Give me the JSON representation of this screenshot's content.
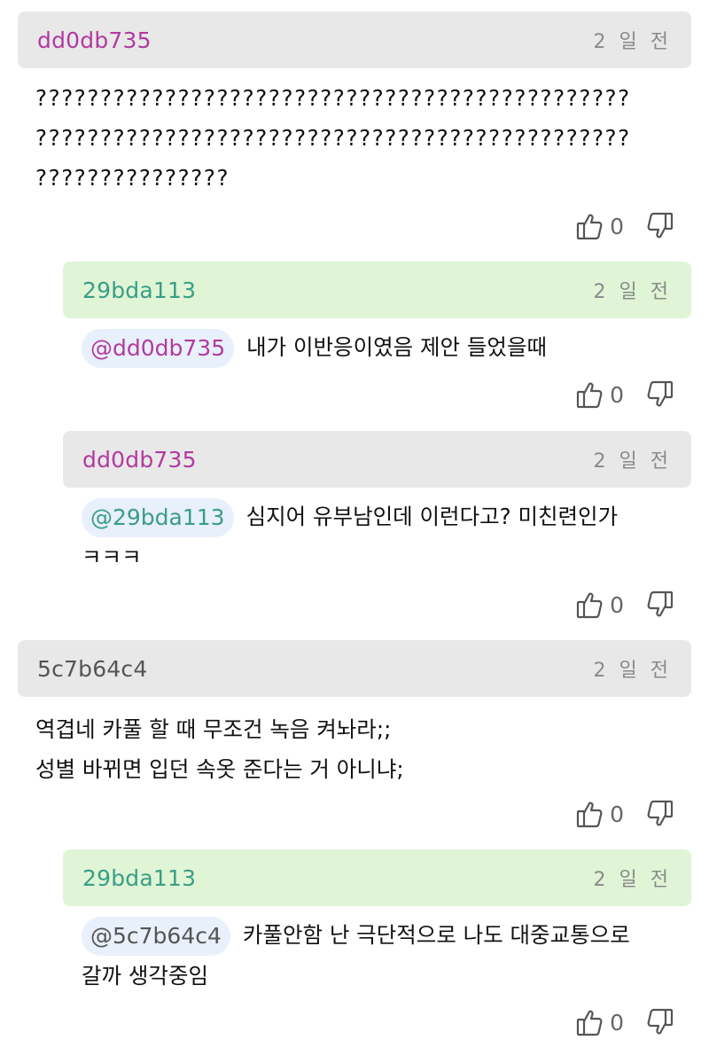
{
  "comments": [
    {
      "author": "dd0db735",
      "time": "2 일 전",
      "text": "?????????????????????????????????????????????????????????????????????????????????????????????????????????",
      "lines": [
        "??????????????????????????????????????????????",
        "??????????????????????????????????????????????",
        "???????????????"
      ],
      "likes": "0",
      "replies": [
        {
          "author": "29bda113",
          "time": "2 일 전",
          "mention": "@dd0db735",
          "lines": [
            "내가 이반응이였음 제안 들었을때"
          ],
          "likes": "0"
        },
        {
          "author": "dd0db735",
          "time": "2 일 전",
          "mention": "@29bda113",
          "lines": [
            "심지어 유부남인데 이런다고? 미친련인가",
            "ㅋㅋㅋ"
          ],
          "likes": "0"
        }
      ]
    },
    {
      "author": "5c7b64c4",
      "time": "2 일 전",
      "lines": [
        "역겹네 카풀 할 때 무조건 녹음 켜놔라;;",
        "성별 바뀌면 입던 속옷 준다는 거 아니냐;"
      ],
      "likes": "0",
      "replies": [
        {
          "author": "29bda113",
          "time": "2 일 전",
          "mention": "@5c7b64c4",
          "lines": [
            "카풀안함 난 극단적으로 나도 대중교통으로",
            "갈까 생각중임"
          ],
          "likes": "0"
        }
      ]
    }
  ],
  "colors": {
    "header_gray": "#e8e8e8",
    "header_green": "#dff5d6",
    "author_purple": "#b23aa0",
    "author_teal": "#3a9e85",
    "author_gray": "#555555",
    "mention_bg": "#e8f0fb"
  },
  "icons": {
    "like": "thumbs-up-icon",
    "dislike": "thumbs-down-icon"
  }
}
